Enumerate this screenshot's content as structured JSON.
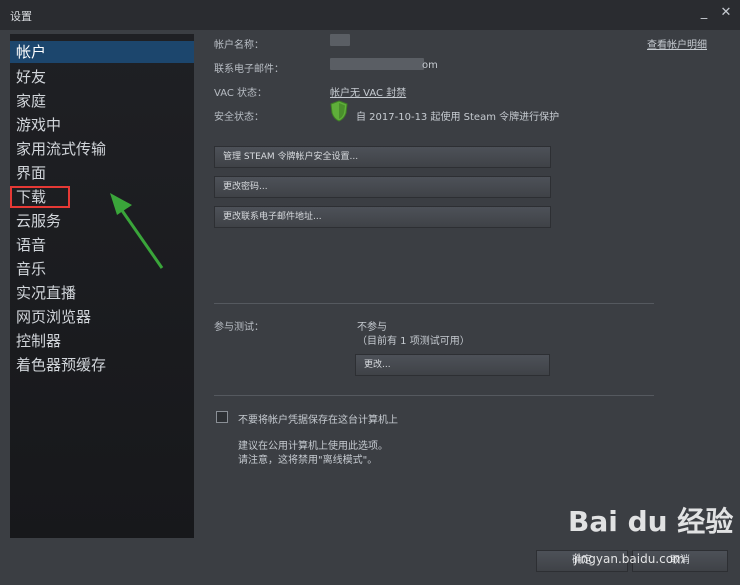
{
  "window": {
    "title": "设置",
    "minimize_glyph": "_",
    "close_glyph": "✕"
  },
  "sidebar": {
    "items": [
      {
        "label": "帐户"
      },
      {
        "label": "好友"
      },
      {
        "label": "家庭"
      },
      {
        "label": "游戏中"
      },
      {
        "label": "家用流式传输"
      },
      {
        "label": "界面"
      },
      {
        "label": "下载"
      },
      {
        "label": "云服务"
      },
      {
        "label": "语音"
      },
      {
        "label": "音乐"
      },
      {
        "label": "实况直播"
      },
      {
        "label": "网页浏览器"
      },
      {
        "label": "控制器"
      },
      {
        "label": "着色器预缓存"
      }
    ]
  },
  "account": {
    "name_label": "帐户名称：",
    "view_details_link": "查看帐户明细",
    "email_label": "联系电子邮件：",
    "email_visible_suffix": "om",
    "vac_label": "VAC 状态：",
    "vac_value": "帐户无 VAC 封禁",
    "security_label": "安全状态：",
    "security_value": "自 2017-10-13 起使用 Steam 令牌进行保护"
  },
  "buttons": {
    "manage_guard": "管理 STEAM 令牌帐户安全设置...",
    "change_password": "更改密码...",
    "change_email": "更改联系电子邮件地址..."
  },
  "beta": {
    "label": "参与测试：",
    "status": "不参与",
    "available": "（目前有 1 项测试可用）",
    "change_button": "更改..."
  },
  "credentials": {
    "checkbox_label": "不要将帐户凭据保存在这台计算机上",
    "note_line1": "建议在公用计算机上使用此选项。",
    "note_line2": "请注意，这将禁用\"离线模式\"。"
  },
  "footer": {
    "ok": "确定",
    "cancel": "取消"
  },
  "watermark": {
    "main": "Bai du 经验",
    "sub": "jingyan.baidu.com"
  },
  "colors": {
    "active_nav": "#1c466d",
    "highlight_box": "#e53935",
    "arrow": "#3aa53a",
    "shield": "#5fae3a"
  }
}
